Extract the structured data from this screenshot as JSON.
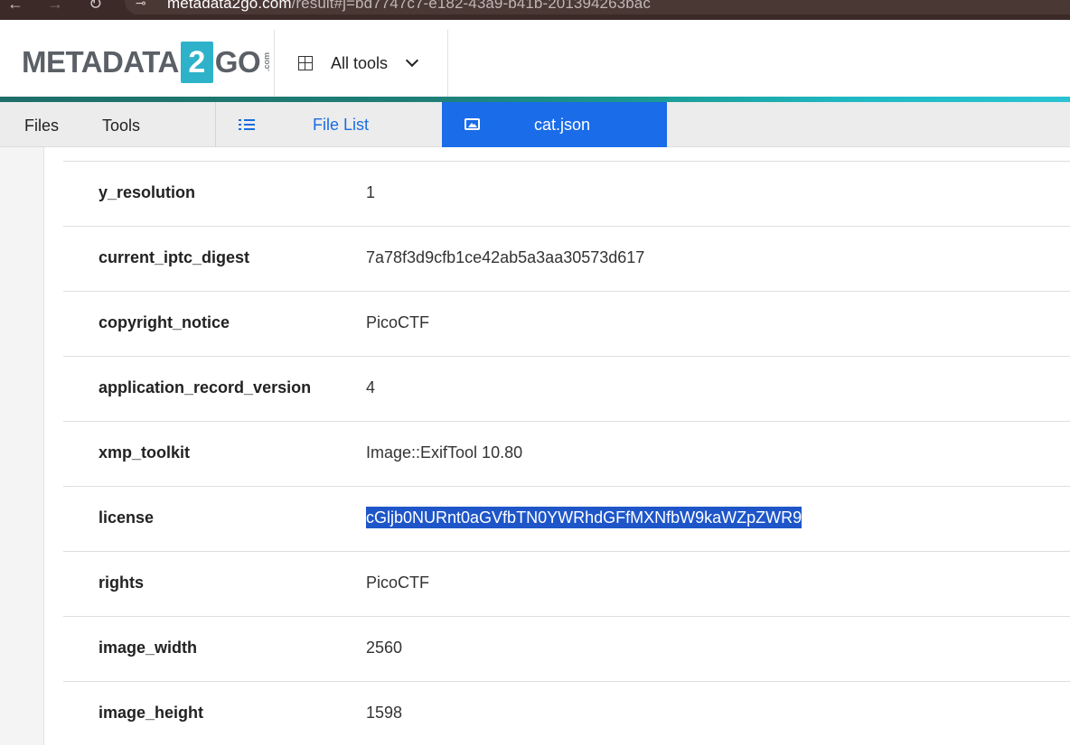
{
  "browser": {
    "back_icon": "←",
    "forward_icon": "→",
    "reload_icon": "↻",
    "site_icon": "⊸",
    "url_host": "metadata2go.com",
    "url_path": "/result#j=bd7747c7-e182-43a9-b41b-201394263bac"
  },
  "header": {
    "logo_left": "METADATA",
    "logo_badge": "2",
    "logo_right": "GO",
    "logo_com": ".com",
    "all_tools_label": "All tools"
  },
  "tabs": {
    "files": "Files",
    "tools": "Tools",
    "file_list": "File List",
    "active_file": "cat.json"
  },
  "metadata": [
    {
      "key": "y_resolution",
      "value": "1"
    },
    {
      "key": "current_iptc_digest",
      "value": "7a78f3d9cfb1ce42ab5a3aa30573d617"
    },
    {
      "key": "copyright_notice",
      "value": "PicoCTF"
    },
    {
      "key": "application_record_version",
      "value": "4"
    },
    {
      "key": "xmp_toolkit",
      "value": "Image::ExifTool 10.80"
    },
    {
      "key": "license",
      "value": "cGljb0NURnt0aGVfbTN0YWRhdGFfMXNfbW9kaWZpZWR9",
      "selected": true
    },
    {
      "key": "rights",
      "value": "PicoCTF"
    },
    {
      "key": "image_width",
      "value": "2560"
    },
    {
      "key": "image_height",
      "value": "1598"
    }
  ],
  "colors": {
    "accent_blue": "#1a6ce8",
    "selection_blue": "#1e56c9",
    "brand_teal": "#2db2c9"
  }
}
